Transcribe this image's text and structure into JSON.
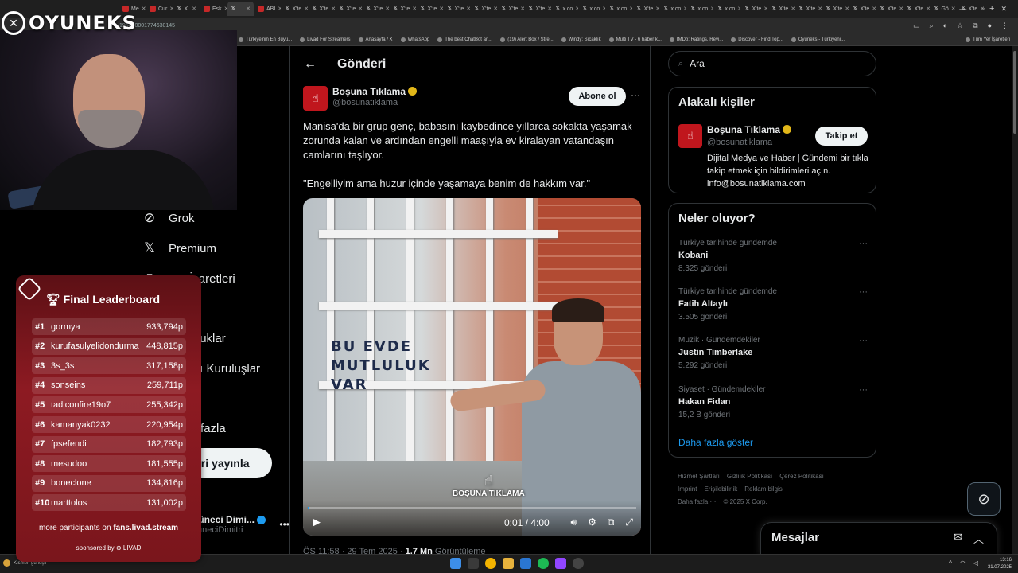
{
  "browser": {
    "tabs": [
      {
        "label": "Me",
        "icon": "red"
      },
      {
        "label": "Cur",
        "icon": "red"
      },
      {
        "label": "X",
        "icon": "x"
      },
      {
        "label": "Esk",
        "icon": "red"
      },
      {
        "label": "",
        "icon": "x",
        "active": true
      },
      {
        "label": "ABI",
        "icon": "red"
      },
      {
        "label": "X'te",
        "icon": "x"
      },
      {
        "label": "X'te",
        "icon": "x"
      },
      {
        "label": "X'te",
        "icon": "x"
      },
      {
        "label": "X'te",
        "icon": "x"
      },
      {
        "label": "X'te",
        "icon": "x"
      },
      {
        "label": "X'te",
        "icon": "x"
      },
      {
        "label": "X'te",
        "icon": "x"
      },
      {
        "label": "X'te",
        "icon": "x"
      },
      {
        "label": "X'te",
        "icon": "x"
      },
      {
        "label": "X'te",
        "icon": "x"
      },
      {
        "label": "x.co",
        "icon": "x"
      },
      {
        "label": "x.co",
        "icon": "x"
      },
      {
        "label": "x.co",
        "icon": "x"
      },
      {
        "label": "X'te",
        "icon": "x"
      },
      {
        "label": "x.co",
        "icon": "x"
      },
      {
        "label": "x.co",
        "icon": "x"
      },
      {
        "label": "x.co",
        "icon": "x"
      },
      {
        "label": "X'te",
        "icon": "x"
      },
      {
        "label": "X'te",
        "icon": "x"
      },
      {
        "label": "X'te",
        "icon": "x"
      },
      {
        "label": "X'te",
        "icon": "x"
      },
      {
        "label": "X'te",
        "icon": "x"
      },
      {
        "label": "X'te",
        "icon": "x"
      },
      {
        "label": "X'te",
        "icon": "x"
      },
      {
        "label": "Gö",
        "icon": "x"
      },
      {
        "label": "X'te",
        "icon": "x"
      }
    ],
    "url_fragment": "1950300017746301​45",
    "bookmarks": [
      "Türkiye'nin En Büyü...",
      "Livad For Streamers",
      "Anasayfa / X",
      "WhatsApp",
      "The best ChatBot an...",
      "(19) Alert Box / Stre...",
      "Windy: Sıcaklık",
      "Multi TV - 6 haber k...",
      "IMDb: Ratings, Revi...",
      "Discover - Find Top...",
      "Oyuneks - Türkiyeni..."
    ],
    "all_bookmarks": "Tüm Yer İşaretleri"
  },
  "nav": {
    "items": [
      {
        "icon": "grok-icon",
        "label": "Grok"
      },
      {
        "icon": "x-premium-icon",
        "label": "Premium"
      },
      {
        "icon": "bookmark-icon",
        "label": "Yer İşaretleri"
      },
      {
        "icon": "jobs-icon",
        "label": ""
      },
      {
        "icon": "communities-icon",
        "label": "Topluluklar"
      },
      {
        "icon": "org-icon",
        "label": "Onaylı Kuruluşlar"
      },
      {
        "icon": "profile-icon",
        "label": ""
      },
      {
        "icon": "more-icon",
        "label": "Daha fazla"
      }
    ],
    "post_button": "Gönderi yayınla",
    "user_name": "Mühendis Müneci Dimi...",
    "user_handle": "@MuhendisMuneciDimitri"
  },
  "post": {
    "header_title": "Gönderi",
    "author_name": "Boşuna Tıklama",
    "author_handle": "@bosunatiklama",
    "subscribe": "Abone ol",
    "text_1": "Manisa'da bir grup genç, babasını kaybedince yıllarca sokakta yaşamak zorunda kalan ve ardından engelli maaşıyla ev kiralayan vatandaşın camlarını taşlıyor.",
    "text_2": "\"Engelliyim ama huzur içinde yaşamaya benim de hakkım var.\"",
    "video": {
      "current": "0:01",
      "duration": "4:00",
      "progress_fraction": 0.004,
      "watermark": "BOŞUNA TIKLAMA",
      "window_sign": "BU EVDE MUTLULUK VAR"
    },
    "meta_time": "ÖS 11:58 · 29 Tem 2025 · ",
    "meta_views": "1,7 Mn",
    "meta_views_label": " Görüntüleme"
  },
  "right": {
    "search_placeholder": "Ara",
    "related_title": "Alakalı kişiler",
    "related_name": "Boşuna Tıklama",
    "related_handle": "@bosunatiklama",
    "follow": "Takip et",
    "related_bio": "Dijital Medya ve Haber | Gündemi bir tıkla takip etmek için bildirimleri açın. info@bosunatiklama.com",
    "trends_title": "Neler oluyor?",
    "trends": [
      {
        "context": "Türkiye tarihinde gündemde",
        "name": "Kobani",
        "posts": "8.325 gönderi"
      },
      {
        "context": "Türkiye tarihinde gündemde",
        "name": "Fatih Altaylı",
        "posts": "3.505 gönderi"
      },
      {
        "context": "Müzik · Gündemdekiler",
        "name": "Justin Timberlake",
        "posts": "5.292 gönderi"
      },
      {
        "context": "Siyaset · Gündemdekiler",
        "name": "Hakan Fidan",
        "posts": "15,2 B gönderi"
      }
    ],
    "show_more": "Daha fazla göster",
    "footer": [
      "Hizmet Şartları",
      "Gizlilik Politikası",
      "Çerez Politikası",
      "Imprint",
      "Erişilebilirlik",
      "Reklam bilgisi",
      "Daha fazla ···",
      "© 2025 X Corp."
    ],
    "messages": "Mesajlar"
  },
  "overlay": {
    "logo": "OYUNEKS",
    "leaderboard_title": "Final Leaderboard",
    "leaderboard": [
      {
        "rank": "#1",
        "name": "gormya",
        "score": "933,794p"
      },
      {
        "rank": "#2",
        "name": "kurufasulyelidondurma",
        "score": "448,815p"
      },
      {
        "rank": "#3",
        "name": "3s_3s",
        "score": "317,158p"
      },
      {
        "rank": "#4",
        "name": "sonseins",
        "score": "259,711p"
      },
      {
        "rank": "#5",
        "name": "tadiconfire19o7",
        "score": "255,342p"
      },
      {
        "rank": "#6",
        "name": "kamanyak0232",
        "score": "220,954p"
      },
      {
        "rank": "#7",
        "name": "fpsefendi",
        "score": "182,793p"
      },
      {
        "rank": "#8",
        "name": "mesudoo",
        "score": "181,555p"
      },
      {
        "rank": "#9",
        "name": "boneclone",
        "score": "134,816p"
      },
      {
        "rank": "#10",
        "name": "marttolos",
        "score": "131,002p"
      }
    ],
    "more_participants": "more participants on ",
    "more_participants_site": "fans.livad.stream",
    "sponsored": "sponsored by ⊛ LIVAD"
  },
  "taskbar": {
    "weather": "Kısmen güneşli",
    "time": "13:16",
    "date": "31.07.2025"
  },
  "colors": {
    "accent": "#1d9bf0",
    "brand_red": "#c0161d",
    "leaderboard_red": "#8d1a22"
  }
}
